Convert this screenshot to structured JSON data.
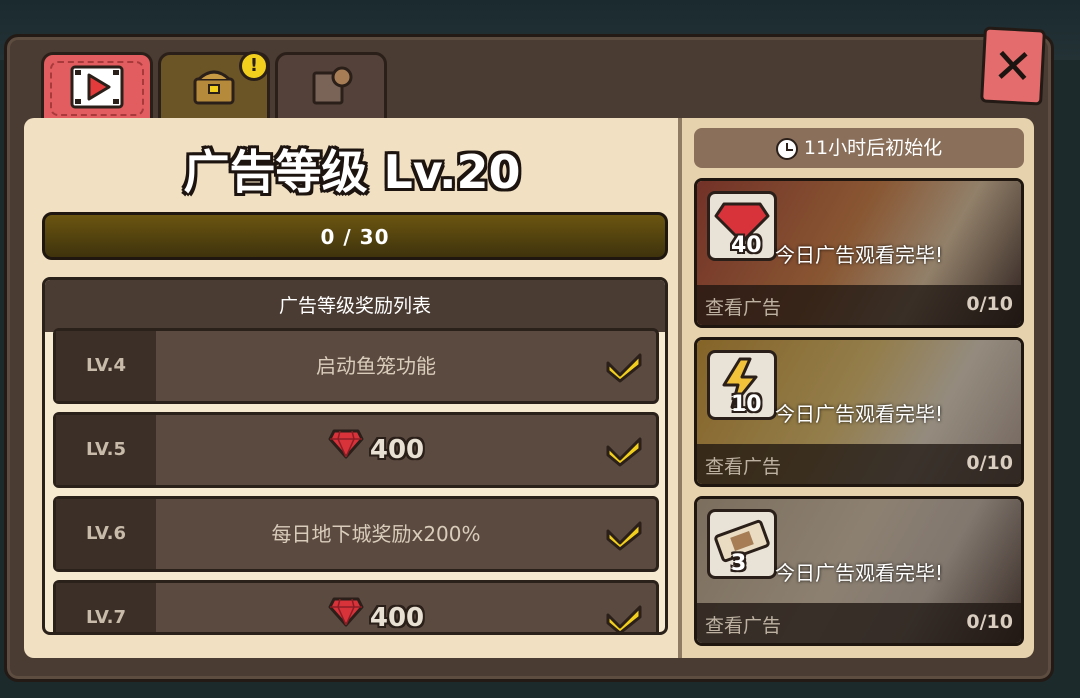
{
  "tabs": [
    {
      "name": "video-tab",
      "icon": "film-play-icon",
      "active": true
    },
    {
      "name": "chest-tab",
      "icon": "treasure-chest-icon",
      "badge": "!"
    },
    {
      "name": "book-tab",
      "icon": "book-coin-icon"
    }
  ],
  "close_label": "✕",
  "ad_level": {
    "title": "广告等级 Lv.20",
    "progress_text": "0 / 30",
    "progress_value": 0,
    "progress_max": 30
  },
  "reward_list": {
    "header": "广告等级奖励列表",
    "rows": [
      {
        "level": "LV.4",
        "reward": "启动鱼笼功能",
        "type": "text",
        "claimed": true
      },
      {
        "level": "LV.5",
        "reward": "400",
        "type": "gem",
        "claimed": true
      },
      {
        "level": "LV.6",
        "reward": "每日地下城奖励x200%",
        "type": "text",
        "claimed": true
      },
      {
        "level": "LV.7",
        "reward": "400",
        "type": "gem",
        "claimed": true
      }
    ]
  },
  "reset": {
    "text": "11小时后初始化",
    "icon": "clock-icon"
  },
  "ad_cards": [
    {
      "reward_icon": "ruby-gem-icon",
      "reward_amount": "40",
      "status": "今日广告观看完毕!",
      "watch_label": "查看广告",
      "count": "0/10",
      "accent": "#d9473f"
    },
    {
      "reward_icon": "lightning-icon",
      "reward_amount": "10",
      "status": "今日广告观看完毕!",
      "watch_label": "查看广告",
      "count": "0/10",
      "accent": "#f1c23a"
    },
    {
      "reward_icon": "ticket-icon",
      "reward_amount": "3",
      "status": "今日广告观看完毕!",
      "watch_label": "查看广告",
      "count": "0/10",
      "accent": "#a89880"
    }
  ]
}
